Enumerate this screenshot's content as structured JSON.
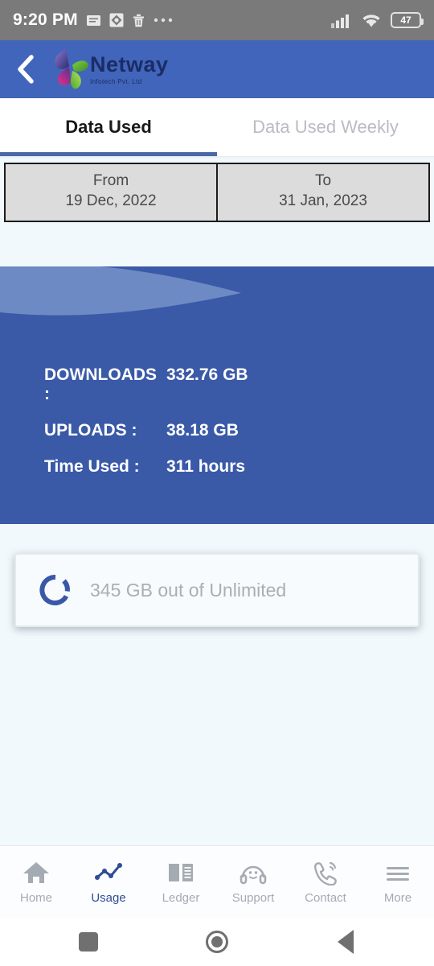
{
  "status_bar": {
    "time": "9:20 PM",
    "battery_level": "47",
    "icons": [
      "message-icon",
      "photos-sync-icon",
      "trash-icon",
      "more-dots-icon",
      "cellular-signal-icon",
      "wifi-icon",
      "battery-icon"
    ]
  },
  "app_bar": {
    "back_icon": "chevron-left-icon",
    "brand_name": "Netway",
    "brand_tagline": "Infotech Pvt. Ltd"
  },
  "tabs": [
    {
      "label": "Data Used",
      "active": true
    },
    {
      "label": "Data Used Weekly",
      "active": false
    }
  ],
  "date_range": {
    "from": {
      "label": "From",
      "value": "19 Dec, 2022"
    },
    "to": {
      "label": "To",
      "value": "31 Jan, 2023"
    }
  },
  "usage_summary": {
    "rows": [
      {
        "label": "DOWNLOADS :",
        "value": "332.76 GB"
      },
      {
        "label": "UPLOADS :",
        "value": "38.18 GB"
      },
      {
        "label": "Time Used :",
        "value": "311 hours"
      }
    ]
  },
  "quota": {
    "icon": "donut-progress-icon",
    "text": "345 GB out of Unlimited"
  },
  "bottom_nav": [
    {
      "label": "Home",
      "icon": "home-icon",
      "active": false
    },
    {
      "label": "Usage",
      "icon": "line-chart-icon",
      "active": true
    },
    {
      "label": "Ledger",
      "icon": "book-icon",
      "active": false
    },
    {
      "label": "Support",
      "icon": "headset-icon",
      "active": false
    },
    {
      "label": "Contact",
      "icon": "phone-call-icon",
      "active": false
    },
    {
      "label": "More",
      "icon": "hamburger-icon",
      "active": false
    }
  ],
  "android_nav": [
    {
      "icon": "recents-square-icon"
    },
    {
      "icon": "home-circle-icon"
    },
    {
      "icon": "back-triangle-icon"
    }
  ],
  "colors": {
    "app_bar": "#4165BA",
    "hero_panel": "#3A5AA8",
    "wave_light": "#6E8AC4",
    "accent": "#2E4C94",
    "page_background": "#F2F9FD",
    "status_bar": "#7A7A7A"
  }
}
